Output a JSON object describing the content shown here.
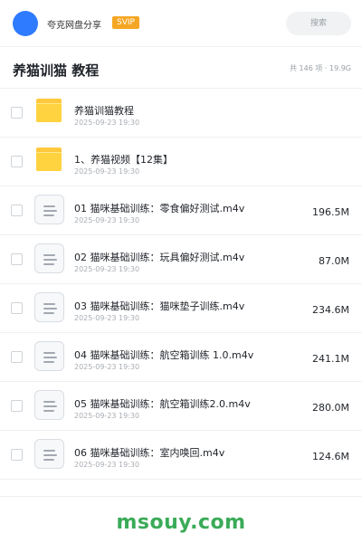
{
  "header": {
    "owner_name": "夸克网盘分享",
    "badge": "SVIP",
    "search_placeholder": "搜索",
    "accent_color": "#2f7bff",
    "badge_color": "#f5a623"
  },
  "folder": {
    "title": "养猫训猫 教程",
    "meta": "共 146 项 · 19.9G"
  },
  "items": [
    {
      "type": "folder",
      "icon": "folder-icon",
      "name": "养猫训猫教程",
      "date": "2025-09-23 19:30",
      "size": ""
    },
    {
      "type": "folder",
      "icon": "folder-icon",
      "name": "1、养猫视频【12集】",
      "date": "2025-09-23 19:30",
      "size": ""
    },
    {
      "type": "file",
      "icon": "file-icon",
      "name": "01 猫咪基础训练：零食偏好测试.m4v",
      "date": "2025-09-23 19:30",
      "size": "196.5M"
    },
    {
      "type": "file",
      "icon": "file-icon",
      "name": "02 猫咪基础训练：玩具偏好测试.m4v",
      "date": "2025-09-23 19:30",
      "size": "87.0M"
    },
    {
      "type": "file",
      "icon": "file-icon",
      "name": "03 猫咪基础训练：猫咪垫子训练.m4v",
      "date": "2025-09-23 19:30",
      "size": "234.6M"
    },
    {
      "type": "file",
      "icon": "file-icon",
      "name": "04 猫咪基础训练：航空箱训练 1.0.m4v",
      "date": "2025-09-23 19:30",
      "size": "241.1M"
    },
    {
      "type": "file",
      "icon": "file-icon",
      "name": "05 猫咪基础训练：航空箱训练2.0.m4v",
      "date": "2025-09-23 19:30",
      "size": "280.0M"
    },
    {
      "type": "file",
      "icon": "file-icon",
      "name": "06 猫咪基础训练：室内唤回.m4v",
      "date": "2025-09-23 19:30",
      "size": "124.6M"
    }
  ],
  "footer": {
    "brand": "msouy.com",
    "brand_color": "#3aab58"
  }
}
